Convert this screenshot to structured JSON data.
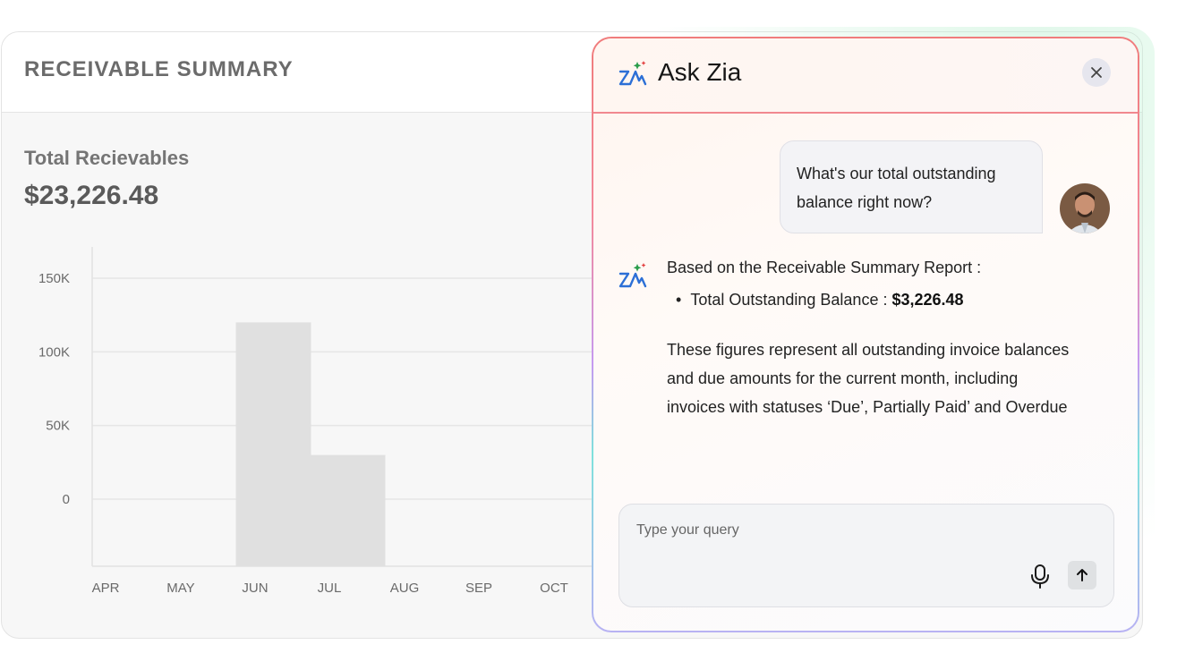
{
  "summary": {
    "title": "RECEIVABLE SUMMARY",
    "total_label": "Total Recievables",
    "total_value": "$23,226.48"
  },
  "chart_data": {
    "type": "bar",
    "categories": [
      "APR",
      "MAY",
      "JUN",
      "JUL",
      "AUG",
      "SEP",
      "OCT"
    ],
    "values": [
      0,
      0,
      120000,
      30000,
      0,
      0,
      0
    ],
    "y_ticks": [
      "150K",
      "100K",
      "50K",
      "0"
    ],
    "ylim": [
      0,
      150000
    ],
    "grid": true,
    "bar_color": "#e0e0e0"
  },
  "zia": {
    "title": "Ask Zia",
    "user_message": "What's our total outstanding balance right now?",
    "reply_intro": "Based on the Receivable Summary Report :",
    "reply_bullet_label": "Total Outstanding Balance :",
    "reply_bullet_value": "$3,226.48",
    "reply_paragraph": "These figures represent all outstanding invoice balances and due amounts for the  current month, including invoices with statuses ‘Due’, Partially Paid’ and Overdue",
    "query_placeholder": "Type your query",
    "icons": {
      "logo": "zia-logo-icon",
      "close": "close-icon",
      "mic": "microphone-icon",
      "send": "arrow-up-icon"
    },
    "colors": {
      "border_top": "#f07c7c",
      "border_bottom": "#b8b2f3",
      "accent_green": "#2a9d4b",
      "accent_red": "#e23b3b",
      "logo_blue": "#2c6fd6"
    }
  }
}
